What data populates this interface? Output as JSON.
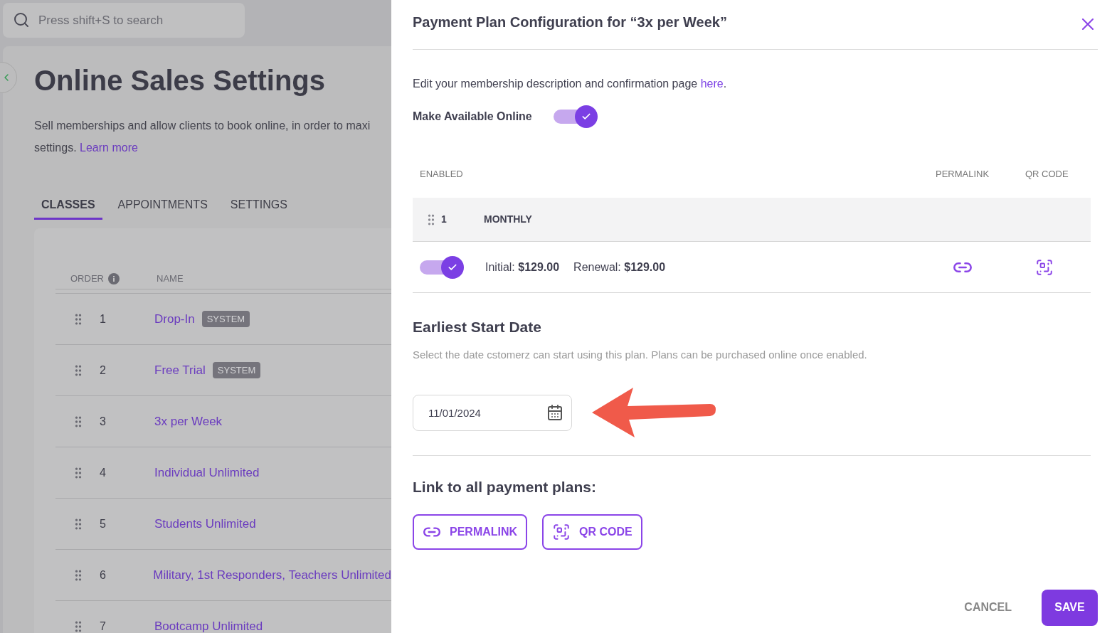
{
  "search": {
    "placeholder": "Press shift+S to search"
  },
  "page": {
    "title": "Online Sales Settings",
    "description_lines": [
      "Sell memberships and allow clients to book online, in order to maxi",
      "settings."
    ],
    "learn_more": "Learn more"
  },
  "tabs": [
    {
      "label": "CLASSES",
      "selected": true
    },
    {
      "label": "APPOINTMENTS",
      "selected": false
    },
    {
      "label": "SETTINGS",
      "selected": false
    }
  ],
  "classes_table": {
    "columns": [
      "ORDER",
      "NAME"
    ],
    "rows": [
      {
        "order": "1",
        "name": "Drop-In",
        "badge": "SYSTEM"
      },
      {
        "order": "2",
        "name": "Free Trial",
        "badge": "SYSTEM"
      },
      {
        "order": "3",
        "name": "3x per Week"
      },
      {
        "order": "4",
        "name": "Individual Unlimited"
      },
      {
        "order": "5",
        "name": "Students Unlimited"
      },
      {
        "order": "6",
        "name": "Military, 1st Responders, Teachers Unlimited"
      },
      {
        "order": "7",
        "name": "Bootcamp Unlimited"
      }
    ]
  },
  "drawer": {
    "title": "Payment Plan Configuration for “3x per Week”",
    "intro": "Edit your membership description and confirmation page",
    "intro_link": "here",
    "intro_end": ".",
    "available_online": {
      "label": "Make Available Online",
      "on": true
    },
    "plans_table": {
      "columns": [
        "ENABLED",
        "PERMALINK",
        "QR CODE"
      ],
      "groups": [
        {
          "order": "1",
          "name": "MONTHLY",
          "plans": [
            {
              "on": true,
              "prices": [
                "Initial: **$129.00**",
                "Renewal: **$129.00**"
              ]
            }
          ]
        }
      ]
    },
    "start_date": {
      "heading": "Earliest Start Date",
      "help": "Select the date cstomerz can start using this plan. Plans can be purchased online once enabled.",
      "value": "11/01/2024"
    },
    "links": {
      "heading": "Link to all payment plans:",
      "buttons": [
        {
          "kind": "permalink",
          "label": "PERMALINK"
        },
        {
          "kind": "qr",
          "label": "QR CODE"
        }
      ]
    },
    "actions": {
      "cancel": "CANCEL",
      "save": "SAVE"
    }
  }
}
